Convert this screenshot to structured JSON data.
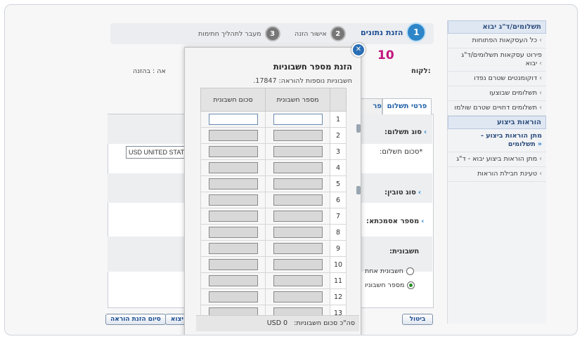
{
  "sidebar": {
    "section1_title": "תשלומים/ד\"ג יבוא",
    "section1_items": [
      {
        "label": "כל העסקאות הפתוחות"
      },
      {
        "label": "פירוט עסקאות תשלומים/ד\"ג יבוא"
      },
      {
        "label": "דוקומנטים שטרם נפדו"
      },
      {
        "label": "תשלומים שבוצעו"
      },
      {
        "label": "תשלומים דחויים שטרם שולמו"
      }
    ],
    "section2_title": "הוראות ביצוע",
    "section2_items": [
      {
        "label": "מתן הוראות ביצוע - תשלומים",
        "bold": true,
        "arrow": "»"
      },
      {
        "label": "מתן הוראות ביצוע יבוא - ד\"ג",
        "arrow": ">"
      },
      {
        "label": "טעינת חבילת הוראות",
        "arrow": ">"
      }
    ]
  },
  "steps": [
    {
      "num": "1",
      "label": "הזנת נתונים",
      "active": true
    },
    {
      "num": "2",
      "label": "אישור הזנה",
      "active": false
    },
    {
      "num": "3",
      "label": "מעבר לתהליך חתימות",
      "active": false
    }
  ],
  "form": {
    "customer_label": "לקוח:",
    "status_text": "אה :  בהזנה",
    "tab_payment_details": "פרטי תשלום",
    "tab_partial": "פר",
    "payment_type_label": "סוג תשלום:",
    "payment_amount_label": "*סכום תשלום:",
    "currency_value": "USD UNITED STAT",
    "goods_type_label": "סוג טובין:",
    "document_number_label": "מספר אסמכתא:",
    "accounts_label": "חשבונית:",
    "radio_single": "חשבונית אחת",
    "radio_multiple": "מספר חשבוניו",
    "cancel_button": "ביטול",
    "finish_button": "סיום הזנת הוראה",
    "export_button": "יצוא"
  },
  "modal": {
    "title": "הזנת מספר חשבוניות",
    "subtitle": "חשבוניות נוספות להוראה: 17847.",
    "col_invoice_number": "מספר חשבונית",
    "col_invoice_amount": "סכום חשבונית",
    "rows": [
      "1",
      "2",
      "3",
      "4",
      "5",
      "6",
      "7",
      "8",
      "9",
      "10",
      "11",
      "12",
      "13"
    ],
    "total_label": "סה\"כ סכום חשבוניות:",
    "total_value": "USD 0"
  },
  "annotation": "10"
}
